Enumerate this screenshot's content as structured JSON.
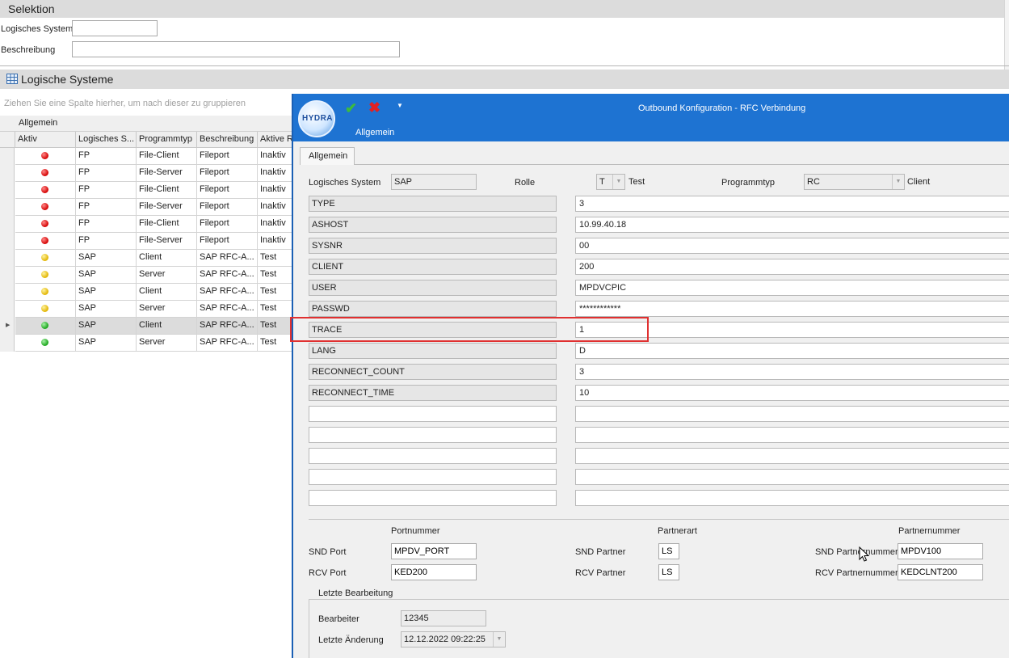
{
  "selection": {
    "title": "Selektion",
    "logical_system_label": "Logisches System",
    "logical_system_value": "",
    "description_label": "Beschreibung",
    "description_value": ""
  },
  "grid": {
    "title": "Logische Systeme",
    "group_hint": "Ziehen Sie eine Spalte hierher, um nach dieser zu gruppieren",
    "band": "Allgemein",
    "columns": [
      "Aktiv",
      "Logisches S...",
      "Programmtyp",
      "Beschreibung",
      "Aktive R"
    ],
    "rows": [
      {
        "status": "red",
        "system": "FP",
        "type": "File-Client",
        "desc": "Fileport",
        "active": "Inaktiv"
      },
      {
        "status": "red",
        "system": "FP",
        "type": "File-Server",
        "desc": "Fileport",
        "active": "Inaktiv"
      },
      {
        "status": "red",
        "system": "FP",
        "type": "File-Client",
        "desc": "Fileport",
        "active": "Inaktiv"
      },
      {
        "status": "red",
        "system": "FP",
        "type": "File-Server",
        "desc": "Fileport",
        "active": "Inaktiv"
      },
      {
        "status": "red",
        "system": "FP",
        "type": "File-Client",
        "desc": "Fileport",
        "active": "Inaktiv"
      },
      {
        "status": "red",
        "system": "FP",
        "type": "File-Server",
        "desc": "Fileport",
        "active": "Inaktiv"
      },
      {
        "status": "yellow",
        "system": "SAP",
        "type": "Client",
        "desc": "SAP RFC-A...",
        "active": "Test"
      },
      {
        "status": "yellow",
        "system": "SAP",
        "type": "Server",
        "desc": "SAP RFC-A...",
        "active": "Test"
      },
      {
        "status": "yellow",
        "system": "SAP",
        "type": "Client",
        "desc": "SAP RFC-A...",
        "active": "Test"
      },
      {
        "status": "yellow",
        "system": "SAP",
        "type": "Server",
        "desc": "SAP RFC-A...",
        "active": "Test"
      },
      {
        "status": "green",
        "system": "SAP",
        "type": "Client",
        "desc": "SAP RFC-A...",
        "active": "Test"
      },
      {
        "status": "green",
        "system": "SAP",
        "type": "Server",
        "desc": "SAP RFC-A...",
        "active": "Test"
      }
    ],
    "selected_row": 10,
    "status_colors": {
      "red": "#d40000",
      "yellow": "#e1b400",
      "green": "#1aa51a"
    }
  },
  "dialog": {
    "title": "Outbound Konfiguration - RFC Verbindung",
    "logo_text": "HYDRA",
    "ribbon_label": "Allgemein",
    "tab": "Allgemein",
    "logical_system_label": "Logisches System",
    "logical_system_value": "SAP",
    "role_label": "Rolle",
    "role_value": "T",
    "role_text": "Test",
    "program_type_label": "Programmtyp",
    "program_type_value": "RC",
    "program_type_text": "Client",
    "params": [
      {
        "name": "TYPE",
        "value": "3"
      },
      {
        "name": "ASHOST",
        "value": "10.99.40.18"
      },
      {
        "name": "SYSNR",
        "value": "00"
      },
      {
        "name": "CLIENT",
        "value": "200"
      },
      {
        "name": "USER",
        "value": "MPDVCPIC"
      },
      {
        "name": "PASSWD",
        "value": "************"
      },
      {
        "name": "TRACE",
        "value": "1"
      },
      {
        "name": "LANG",
        "value": "D"
      },
      {
        "name": "RECONNECT_COUNT",
        "value": "3"
      },
      {
        "name": "RECONNECT_TIME",
        "value": "10"
      },
      {
        "name": "",
        "value": ""
      },
      {
        "name": "",
        "value": ""
      },
      {
        "name": "",
        "value": ""
      },
      {
        "name": "",
        "value": ""
      },
      {
        "name": "",
        "value": ""
      }
    ],
    "portnummer_header": "Portnummer",
    "partnerart_header": "Partnerart",
    "partnernummer_header": "Partnernummer",
    "snd_port_label": "SND Port",
    "snd_port_value": "MPDV_PORT",
    "rcv_port_label": "RCV Port",
    "rcv_port_value": "KED200",
    "snd_partner_label": "SND Partner",
    "snd_partner_value": "LS",
    "rcv_partner_label": "RCV Partner",
    "rcv_partner_value": "LS",
    "snd_partnernummer_label": "SND Partnernummer",
    "snd_partnernummer_value": "MPDV100",
    "rcv_partnernummer_label": "RCV Partnernummer",
    "rcv_partnernummer_value": "KEDCLNT200",
    "last_edit_group": "Letzte Bearbeitung",
    "editor_label": "Bearbeiter",
    "editor_value": "12345",
    "last_change_label": "Letzte Änderung",
    "last_change_value": "12.12.2022 09:22:25",
    "accent_color": "#1e73d2"
  }
}
